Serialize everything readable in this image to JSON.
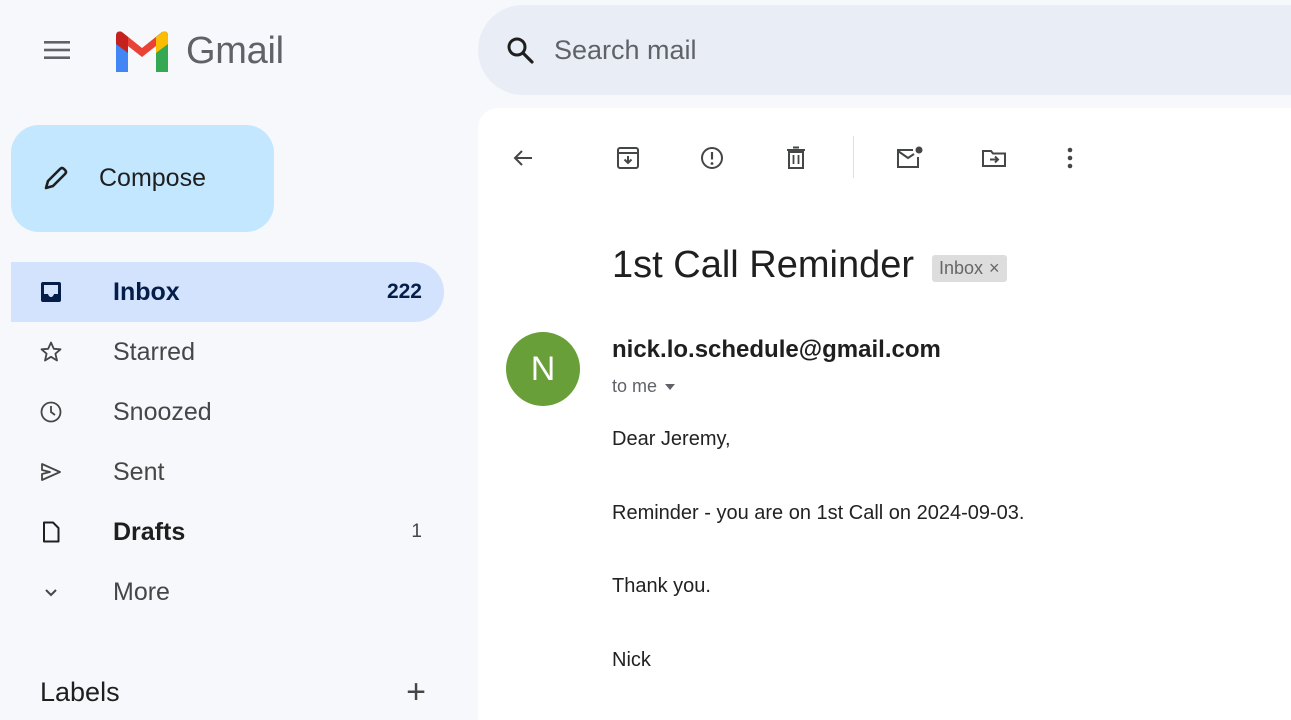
{
  "app": {
    "name": "Gmail"
  },
  "search": {
    "placeholder": "Search mail"
  },
  "compose": {
    "label": "Compose"
  },
  "nav": {
    "items": [
      {
        "label": "Inbox",
        "count": "222",
        "icon": "inbox-icon",
        "active": true
      },
      {
        "label": "Starred",
        "count": "",
        "icon": "star-icon"
      },
      {
        "label": "Snoozed",
        "count": "",
        "icon": "clock-icon"
      },
      {
        "label": "Sent",
        "count": "",
        "icon": "send-icon"
      },
      {
        "label": "Drafts",
        "count": "1",
        "icon": "draft-icon"
      },
      {
        "label": "More",
        "count": "",
        "icon": "chevron-down-icon"
      }
    ]
  },
  "labels": {
    "title": "Labels",
    "add": "+"
  },
  "toolbar": {
    "icons": [
      "back-arrow-icon",
      "archive-icon",
      "report-spam-icon",
      "delete-icon",
      "mark-unread-icon",
      "move-to-icon",
      "more-vert-icon"
    ]
  },
  "email": {
    "subject": "1st Call Reminder",
    "chip": "Inbox",
    "chip_close": "×",
    "avatar_letter": "N",
    "avatar_color": "#689f38",
    "sender": "nick.lo.schedule@gmail.com",
    "to": "to me",
    "body": [
      "Dear Jeremy,",
      "Reminder - you are on 1st Call on 2024-09-03.",
      "Thank you.",
      "Nick"
    ]
  },
  "colors": {
    "compose_bg": "#c2e7ff",
    "active_nav_bg": "#d3e3fd",
    "background": "#f6f8fc",
    "search_bg": "#e9eef6"
  }
}
